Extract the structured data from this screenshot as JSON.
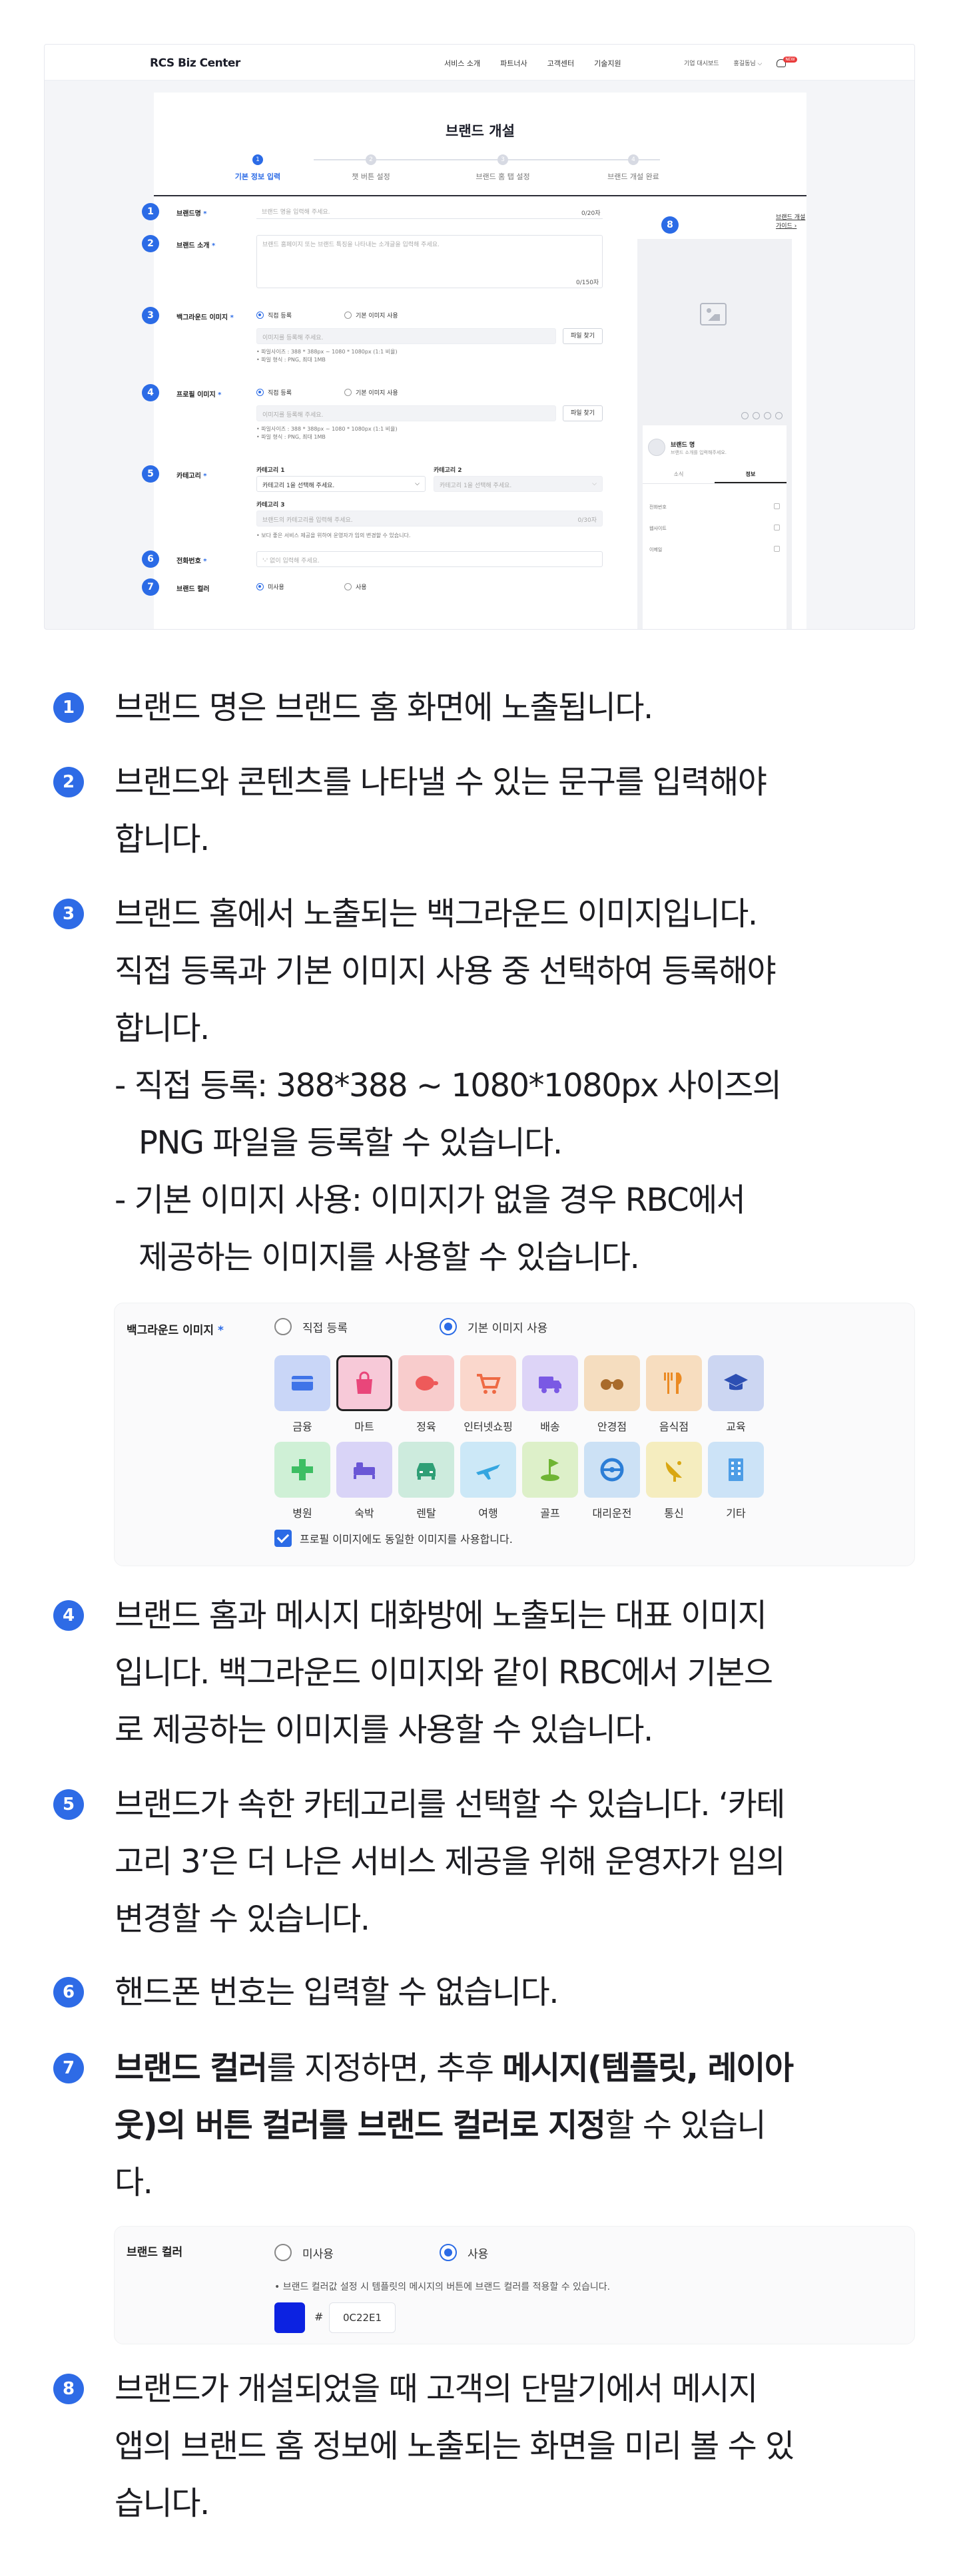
{
  "colors": {
    "accent": "#2B6BE6",
    "brand_color": "#0C22E1"
  },
  "screen": {
    "logo": "RCS Biz Center",
    "nav": [
      "서비스 소개",
      "파트너사",
      "고객센터",
      "기술지원"
    ],
    "util": [
      "기업 대시보드",
      "홍길동님"
    ],
    "bell_badge": "NEW",
    "title": "브랜드 개설",
    "steps": [
      "기본 정보 입력",
      "챗 버튼 설정",
      "브랜드 홈 탭 설정",
      "브랜드 개설 완료"
    ],
    "step_active": 1,
    "help_link": "브랜드 개설 가이드",
    "fields": {
      "brand_name": {
        "label": "브랜드명",
        "placeholder": "브랜드 명을 입력해 주세요.",
        "count": "0/20자"
      },
      "brand_intro": {
        "label": "브랜드 소개",
        "placeholder": "브랜드 홈페이지 또는 브랜드 특징을 나타내는 소개글을 입력해 주세요.",
        "count": "0/150자"
      },
      "background": {
        "label": "백그라운드 이미지",
        "opt1": "직접 등록",
        "opt2": "기본 이미지 사용",
        "placeholder": "이미지를 등록해 주세요.",
        "button": "파일 찾기",
        "notes": [
          "파일사이즈 : 388 * 388px ~ 1080 * 1080px (1:1 비율)",
          "파일 형식 : PNG, 최대 1MB"
        ]
      },
      "profile": {
        "label": "프로필 이미지",
        "opt1": "직접 등록",
        "opt2": "기본 이미지 사용",
        "placeholder": "이미지를 등록해 주세요.",
        "button": "파일 찾기",
        "notes": [
          "파일사이즈 : 388 * 388px ~ 1080 * 1080px (1:1 비율)",
          "파일 형식 : PNG, 최대 1MB"
        ]
      },
      "category": {
        "label": "카테고리",
        "c1": "카테고리 1",
        "c1_value": "카테고리 1을 선택해 주세요.",
        "c2": "카테고리 2",
        "c2_value": "카테고리 1을 선택해 주세요.",
        "c3": "카테고리 3",
        "c3_value": "브랜드의 카테고리를 입력해 주세요.",
        "c3_count": "0/30자",
        "note": "보다 좋은 서비스 제공을 위하여 운영자가 임의 변경할 수 있습니다."
      },
      "phone": {
        "label": "전화번호",
        "placeholder": "'-' 없이 입력해 주세요."
      },
      "brand_color": {
        "label": "브랜드 컬러",
        "opt1": "미사용",
        "opt2": "사용"
      }
    },
    "preview": {
      "brand_name": "브랜드 명",
      "brand_desc": "브랜드 소개를 입력해주세요.",
      "tabs": [
        "소식",
        "정보"
      ],
      "rows": [
        "전화번호",
        "웹사이트",
        "이메일"
      ]
    }
  },
  "items": [
    {
      "num": "1",
      "text": "브랜드 명은 브랜드 홈 화면에 노출됩니다."
    },
    {
      "num": "2",
      "lines": [
        "브랜드와 콘텐츠를 나타낼 수 있는 문구를 입력해야",
        "합니다."
      ]
    },
    {
      "num": "3",
      "lines": [
        "브랜드 홈에서 노출되는 백그라운드 이미지입니다.",
        "직접 등록과 기본 이미지 사용 중 선택하여 등록해야",
        "합니다.",
        "- 직접 등록: 388*388 ~ 1080*1080px 사이즈의",
        "PNG 파일을 등록할 수 있습니다.",
        "- 기본 이미지 사용: 이미지가 없을 경우 RBC에서",
        "제공하는 이미지를 사용할 수 있습니다."
      ]
    },
    {
      "num": "4",
      "lines": [
        "브랜드 홈과 메시지 대화방에 노출되는 대표 이미지",
        "입니다. 백그라운드 이미지와 같이 RBC에서 기본으",
        "로 제공하는 이미지를 사용할 수 있습니다."
      ]
    },
    {
      "num": "5",
      "lines": [
        "브랜드가 속한 카테고리를 선택할 수 있습니다. ‘카테",
        "고리 3’은 더 나은 서비스 제공을 위해 운영자가 임의",
        "변경할 수 있습니다."
      ]
    },
    {
      "num": "6",
      "text": "핸드폰 번호는 입력할 수 없습니다."
    },
    {
      "num": "7",
      "l1a": "브랜드 컬러",
      "l1b": "를 지정하면, 추후 ",
      "l1c": "메시지(템플릿, 레이아",
      "l2a": "웃)의 버튼 컬러를 브랜드 컬러로 지정",
      "l2b": "할 수 있습니",
      "l3": "다."
    },
    {
      "num": "8",
      "lines": [
        "브랜드가 개설되었을 때 고객의 단말기에서 메시지",
        "앱의 브랜드 홈 정보에 노출되는 화면을 미리 볼 수 있",
        "습니다."
      ]
    }
  ],
  "bg_panel": {
    "label": "백그라운드 이미지",
    "opt1": "직접 등록",
    "opt2": "기본 이미지 사용",
    "selected": "기본 이미지 사용",
    "tiles": [
      {
        "label": "금융",
        "icon": "credit-card-icon",
        "bg": "#C9D6F7",
        "fg": "#3F74E8"
      },
      {
        "label": "마트",
        "icon": "shopping-bag-icon",
        "bg": "#F7C9D8",
        "fg": "#E9467A"
      },
      {
        "label": "정육",
        "icon": "meat-icon",
        "bg": "#F8CCCC",
        "fg": "#EE5A5A"
      },
      {
        "label": "인터넷쇼핑",
        "icon": "shopping-cart-icon",
        "bg": "#FAD7CC",
        "fg": "#EE6A44"
      },
      {
        "label": "배송",
        "icon": "delivery-truck-icon",
        "bg": "#DDD4F7",
        "fg": "#7A59E4"
      },
      {
        "label": "안경점",
        "icon": "glasses-icon",
        "bg": "#F5DDBF",
        "fg": "#A96B2B"
      },
      {
        "label": "음식점",
        "icon": "fork-knife-icon",
        "bg": "#F7DDBF",
        "fg": "#EB8A23"
      },
      {
        "label": "교육",
        "icon": "graduation-cap-icon",
        "bg": "#CCD6F2",
        "fg": "#2D4FB3"
      },
      {
        "label": "병원",
        "icon": "medical-cross-icon",
        "bg": "#CFF0D6",
        "fg": "#3DBE63"
      },
      {
        "label": "숙박",
        "icon": "bed-icon",
        "bg": "#D9D4F7",
        "fg": "#6A57D6"
      },
      {
        "label": "렌탈",
        "icon": "car-icon",
        "bg": "#CDEBDD",
        "fg": "#2F9F76"
      },
      {
        "label": "여행",
        "icon": "airplane-icon",
        "bg": "#CCE8F7",
        "fg": "#35A6E0"
      },
      {
        "label": "골프",
        "icon": "golf-icon",
        "bg": "#DDF0C9",
        "fg": "#6FB534"
      },
      {
        "label": "대리운전",
        "icon": "steering-wheel-icon",
        "bg": "#CCE1F5",
        "fg": "#2C7ED6"
      },
      {
        "label": "통신",
        "icon": "satellite-icon",
        "bg": "#F5EDBF",
        "fg": "#D9A712"
      },
      {
        "label": "기타",
        "icon": "building-icon",
        "bg": "#CCE3F7",
        "fg": "#4D9DE6"
      }
    ],
    "checkbox": "프로필 이미지에도 동일한 이미지를 사용합니다."
  },
  "color_panel": {
    "label": "브랜드 컬러",
    "opt1": "미사용",
    "opt2": "사용",
    "selected": "사용",
    "note": "• 브랜드 컬러값 설정 시 템플릿의 메시지의 버튼에 브랜드 컬러를 적용할 수 있습니다.",
    "hash": "#",
    "hex": "0C22E1"
  }
}
